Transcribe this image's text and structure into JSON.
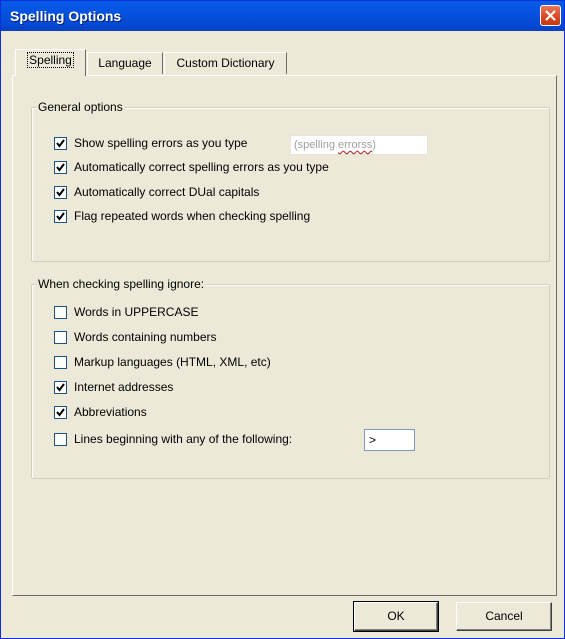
{
  "window": {
    "title": "Spelling Options"
  },
  "tabs": [
    {
      "label": "Spelling",
      "active": true
    },
    {
      "label": "Language",
      "active": false
    },
    {
      "label": "Custom Dictionary",
      "active": false
    }
  ],
  "general": {
    "legend": "General options",
    "options": [
      {
        "label": "Show spelling errors as you type",
        "checked": true
      },
      {
        "label": "Automatically correct spelling errors as you type",
        "checked": true
      },
      {
        "label": "Automatically correct DUal capitals",
        "checked": true
      },
      {
        "label": "Flag repeated words when checking spelling",
        "checked": true
      }
    ],
    "preview_prefix": "(spelling ",
    "preview_error": "errorss",
    "preview_suffix": ")"
  },
  "ignore": {
    "legend": "When checking spelling ignore:",
    "options": [
      {
        "label": "Words in UPPERCASE",
        "checked": false
      },
      {
        "label": "Words containing numbers",
        "checked": false
      },
      {
        "label": "Markup languages (HTML, XML, etc)",
        "checked": false
      },
      {
        "label": "Internet addresses",
        "checked": true
      },
      {
        "label": "Abbreviations",
        "checked": true
      },
      {
        "label": "Lines beginning with any of the following:",
        "checked": false
      }
    ],
    "prefix_value": ">"
  },
  "buttons": {
    "ok": "OK",
    "cancel": "Cancel"
  },
  "colors": {
    "titlebar": "#0552e0",
    "dialog_bg": "#ece9d8",
    "close_button": "#d8471f"
  }
}
